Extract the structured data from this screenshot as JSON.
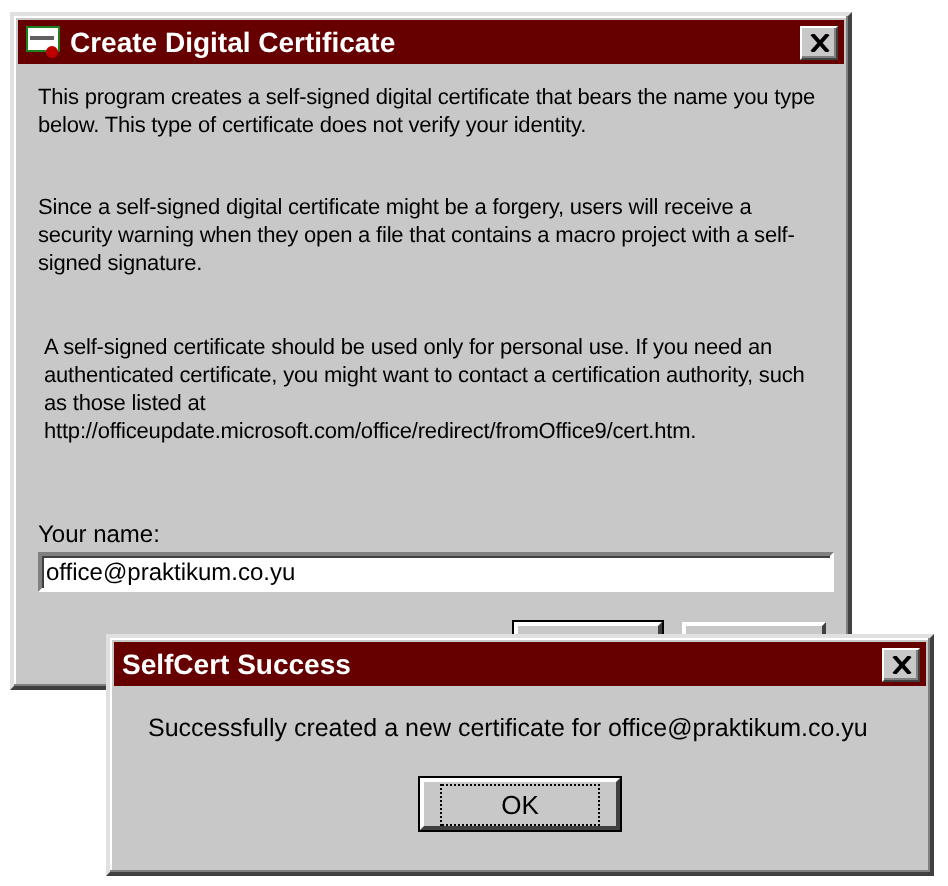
{
  "main_window": {
    "title": "Create Digital Certificate",
    "paragraphs": [
      "This program creates a self-signed digital certificate that bears the name you type below. This type of certificate does not verify your identity.",
      "Since a self-signed digital certificate might be a forgery, users will receive a security warning when they open a file that contains a macro project with a self-signed signature.",
      "A self-signed certificate should be used only for personal use. If you need an authenticated certificate, you might want to contact a certification authority, such as those listed at\nhttp://officeupdate.microsoft.com/office/redirect/fromOffice9/cert.htm."
    ],
    "name_label": "Your name:",
    "name_value": "office@praktikum.co.yu"
  },
  "success_dialog": {
    "title": "SelfCert Success",
    "message": "Successfully created a new certificate for office@praktikum.co.yu",
    "buttons": [
      {
        "label": "OK",
        "focused": true
      }
    ]
  }
}
